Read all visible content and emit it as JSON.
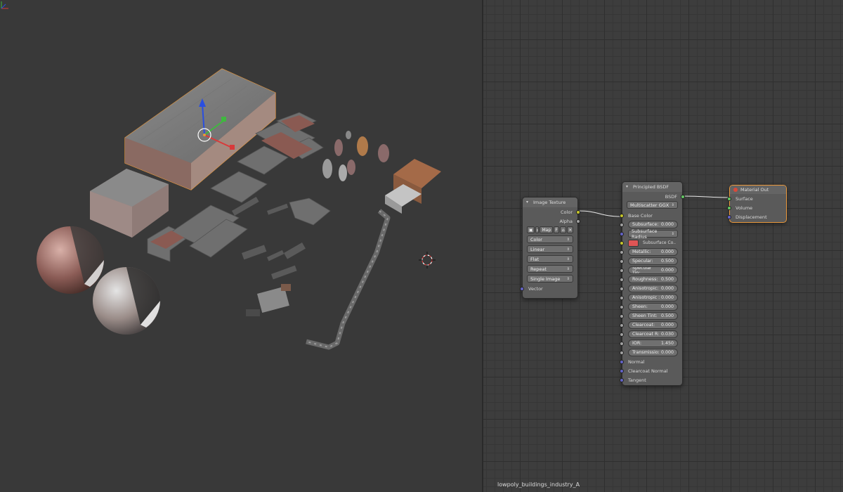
{
  "colors": {
    "viewport_bg": "#393939",
    "node_editor_bg": "#3d3d3d",
    "selection_outline": "#e8973a",
    "socket_color": "#c7c729",
    "socket_float": "#a1a1a1",
    "socket_vector": "#6363c7",
    "socket_shader": "#63c763",
    "subsurface_color": "#e05555"
  },
  "material_name": "lowpoly_buildings_industry_A",
  "image_texture_node": {
    "title": "Image Texture",
    "outputs": [
      "Color",
      "Alpha"
    ],
    "toolbar": {
      "map_label": "Map",
      "fake_user_label": "F"
    },
    "dropdowns": [
      "Color",
      "Linear",
      "Flat",
      "Repeat",
      "Single Image"
    ],
    "inputs": [
      "Vector"
    ]
  },
  "principled_node": {
    "title": "Principled BSDF",
    "output": "BSDF",
    "distribution": "Multiscatter GGX",
    "base_color_label": "Base Color",
    "subsurface_method": "Subsurface Radius",
    "subsurface_color_label": "Subsurface Co..",
    "fields": [
      {
        "label": "Subsurface:",
        "value": "0.000"
      },
      {
        "label": "Metallic:",
        "value": "0.000"
      },
      {
        "label": "Specular:",
        "value": "0.500"
      },
      {
        "label": "Specular Tin:",
        "value": "0.000"
      },
      {
        "label": "Roughness:",
        "value": "0.500"
      },
      {
        "label": "Anisotropic:",
        "value": "0.000"
      },
      {
        "label": "Anisotropic :",
        "value": "0.000"
      },
      {
        "label": "Sheen:",
        "value": "0.000"
      },
      {
        "label": "Sheen Tint:",
        "value": "0.500"
      },
      {
        "label": "Clearcoat:",
        "value": "0.000"
      },
      {
        "label": "Clearcoat R:",
        "value": "0.030"
      },
      {
        "label": "IOR:",
        "value": "1.450"
      },
      {
        "label": "Transmissio:",
        "value": "0.000"
      }
    ],
    "vector_inputs": [
      "Normal",
      "Clearcoat Normal",
      "Tangent"
    ]
  },
  "material_output_node": {
    "title": "Material Out",
    "inputs": [
      "Surface",
      "Volume",
      "Displacement"
    ]
  }
}
